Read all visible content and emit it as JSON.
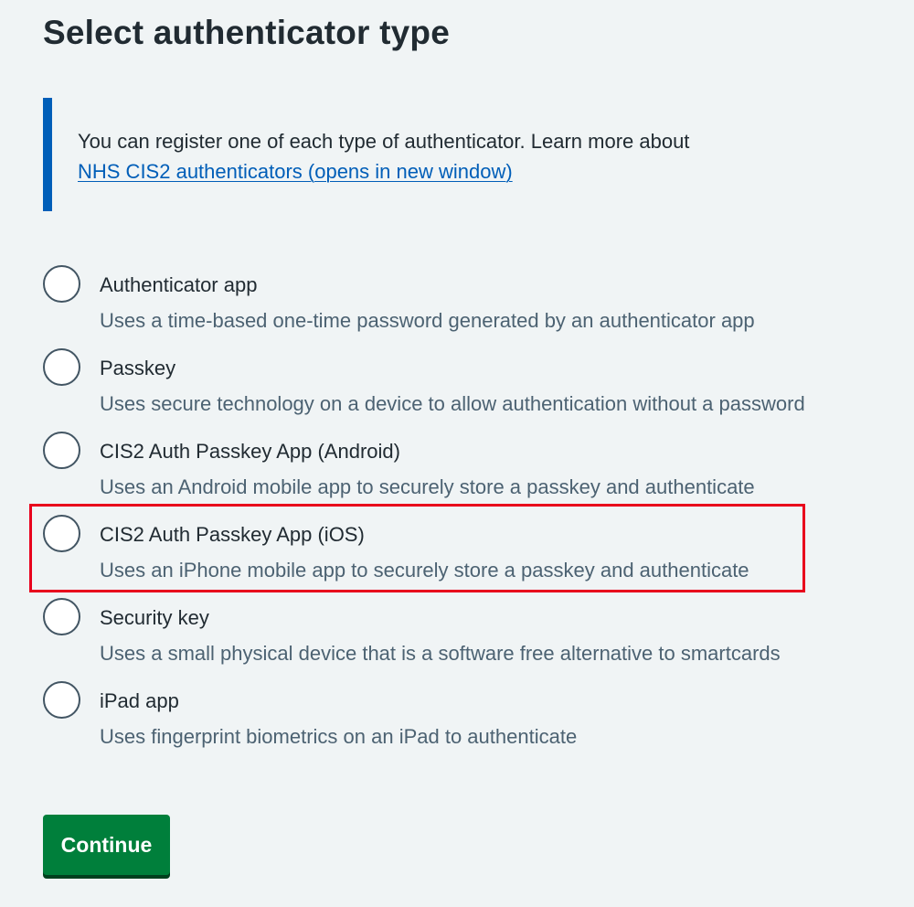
{
  "page": {
    "title": "Select authenticator type"
  },
  "inset": {
    "text": "You can register one of each type of authenticator. Learn more about",
    "link_text": "NHS CIS2 authenticators (opens in new window)"
  },
  "options": [
    {
      "label": "Authenticator app",
      "hint": "Uses a time-based one-time password generated by an authenticator app",
      "selected": false
    },
    {
      "label": "Passkey",
      "hint": "Uses secure technology on a device to allow authentication without a password",
      "selected": false
    },
    {
      "label": "CIS2 Auth Passkey App (Android)",
      "hint": "Uses an Android mobile app to securely store a passkey and authenticate",
      "selected": false
    },
    {
      "label": "CIS2 Auth Passkey App (iOS)",
      "hint": "Uses an iPhone mobile app to securely store a passkey and authenticate",
      "selected": false,
      "highlighted": true
    },
    {
      "label": "Security key",
      "hint": "Uses a small physical device that is a software free alternative to smartcards",
      "selected": false
    },
    {
      "label": "iPad app",
      "hint": "Uses fingerprint biometrics on an iPad to authenticate",
      "selected": false
    }
  ],
  "actions": {
    "continue_label": "Continue"
  },
  "colors": {
    "background": "#f0f4f5",
    "text": "#212b32",
    "hint_text": "#4c6272",
    "link": "#005eb8",
    "inset_border": "#005eb8",
    "button": "#007f3b",
    "button_shadow": "#00401e",
    "highlight": "#e8001c"
  }
}
